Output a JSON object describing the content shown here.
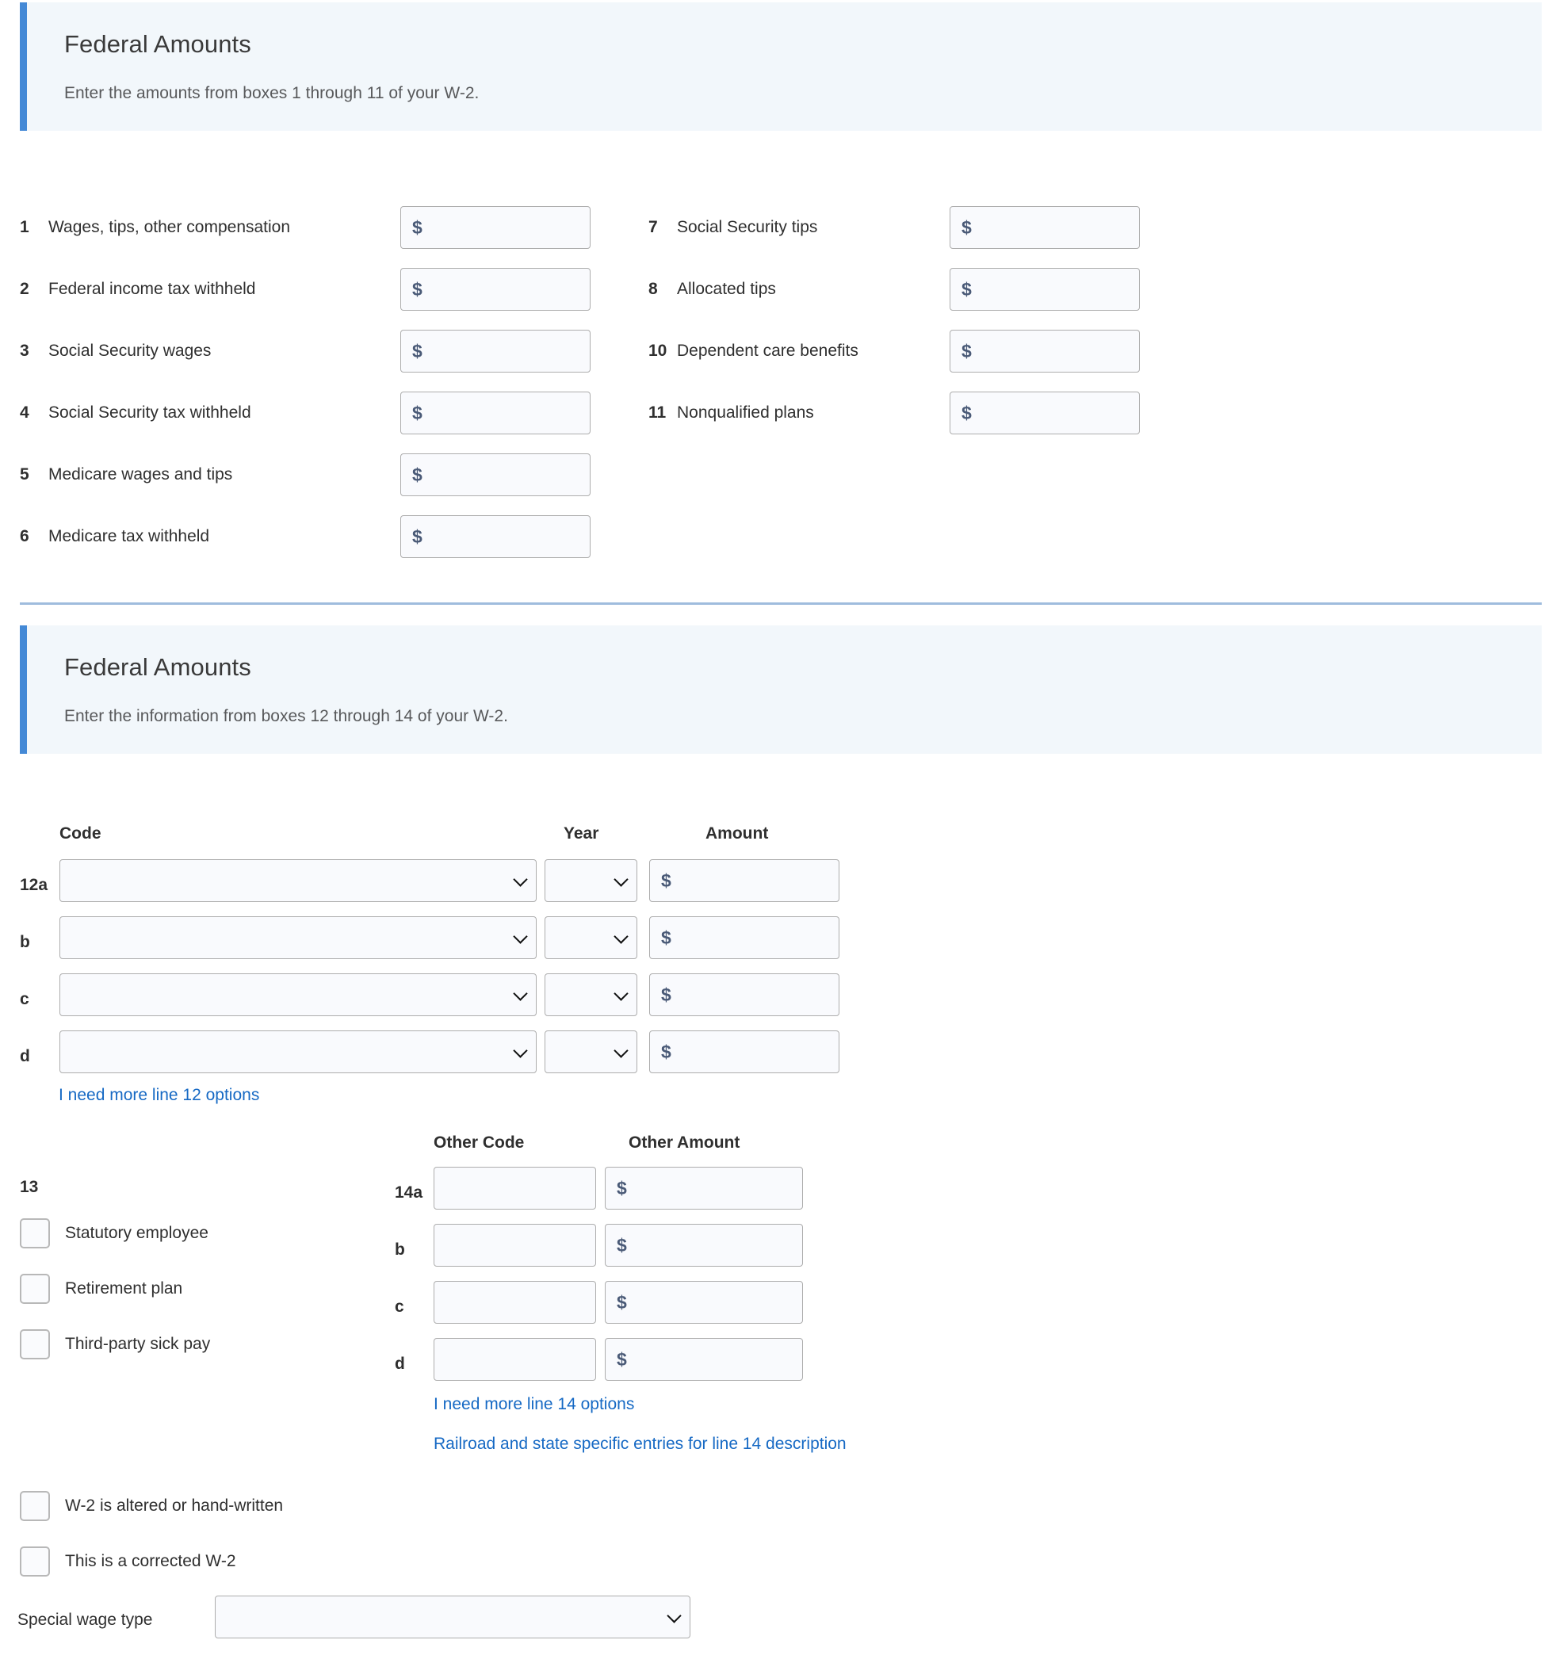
{
  "section1": {
    "title": "Federal Amounts",
    "subtitle": "Enter the amounts from boxes 1 through 11 of your W-2.",
    "currency_symbol": "$",
    "left_fields": [
      {
        "num": "1",
        "label": "Wages, tips, other compensation",
        "value": ""
      },
      {
        "num": "2",
        "label": "Federal income tax withheld",
        "value": ""
      },
      {
        "num": "3",
        "label": "Social Security wages",
        "value": ""
      },
      {
        "num": "4",
        "label": "Social Security tax withheld",
        "value": ""
      },
      {
        "num": "5",
        "label": "Medicare wages and tips",
        "value": ""
      },
      {
        "num": "6",
        "label": "Medicare tax withheld",
        "value": ""
      }
    ],
    "right_fields": [
      {
        "num": "7",
        "label": "Social Security tips",
        "value": ""
      },
      {
        "num": "8",
        "label": "Allocated tips",
        "value": ""
      },
      {
        "num": "10",
        "label": "Dependent care benefits",
        "value": ""
      },
      {
        "num": "11",
        "label": "Nonqualified plans",
        "value": ""
      }
    ]
  },
  "section2": {
    "title": "Federal Amounts",
    "subtitle": "Enter the information from boxes 12 through 14 of your W-2.",
    "currency_symbol": "$",
    "box12": {
      "headers": {
        "code": "Code",
        "year": "Year",
        "amount": "Amount"
      },
      "rows": [
        {
          "marker": "12a",
          "code": "",
          "year": "",
          "amount": ""
        },
        {
          "marker": "b",
          "code": "",
          "year": "",
          "amount": ""
        },
        {
          "marker": "c",
          "code": "",
          "year": "",
          "amount": ""
        },
        {
          "marker": "d",
          "code": "",
          "year": "",
          "amount": ""
        }
      ],
      "more_options_link": "I need more line 12 options"
    },
    "box13": {
      "marker": "13",
      "checkboxes": [
        {
          "label": "Statutory employee",
          "checked": false
        },
        {
          "label": "Retirement plan",
          "checked": false
        },
        {
          "label": "Third-party sick pay",
          "checked": false
        }
      ]
    },
    "box14": {
      "headers": {
        "other_code": "Other Code",
        "other_amount": "Other Amount"
      },
      "rows": [
        {
          "marker": "14a",
          "code": "",
          "amount": ""
        },
        {
          "marker": "b",
          "code": "",
          "amount": ""
        },
        {
          "marker": "c",
          "code": "",
          "amount": ""
        },
        {
          "marker": "d",
          "code": "",
          "amount": ""
        }
      ],
      "more_options_link": "I need more line 14 options",
      "railroad_link": "Railroad and state specific entries for line 14 description"
    },
    "footer": {
      "checkboxes": [
        {
          "label": "W-2 is altered or hand-written",
          "checked": false
        },
        {
          "label": "This is a corrected W-2",
          "checked": false
        }
      ],
      "special_wage_type_label": "Special wage type",
      "special_wage_type_value": ""
    }
  },
  "colors": {
    "accent_stripe": "#4489d6",
    "banner_bg": "#f2f7fb",
    "divider": "#9fbcdd",
    "link": "#1669c4",
    "dollar": "#4a5a77"
  }
}
